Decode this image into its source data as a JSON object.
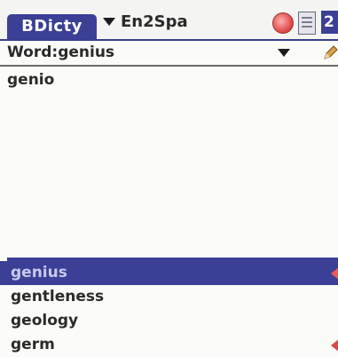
{
  "app": {
    "title": "BDicty",
    "dictionary": "En2Spa"
  },
  "search": {
    "label": "Word:",
    "value": "genius"
  },
  "definition": {
    "text": "genio"
  },
  "word_list": {
    "items": [
      {
        "label": "genius",
        "selected": true
      },
      {
        "label": "gentleness",
        "selected": false
      },
      {
        "label": "geology",
        "selected": false
      },
      {
        "label": "germ",
        "selected": false
      }
    ]
  },
  "colors": {
    "accent": "#3b3f96",
    "scroll_arrow": "#d54a48"
  },
  "icons": [
    "dropdown-arrow-icon",
    "record-icon",
    "document-icon",
    "help-icon",
    "pencil-icon",
    "scroll-up-arrow-icon",
    "scroll-down-arrow-icon"
  ]
}
